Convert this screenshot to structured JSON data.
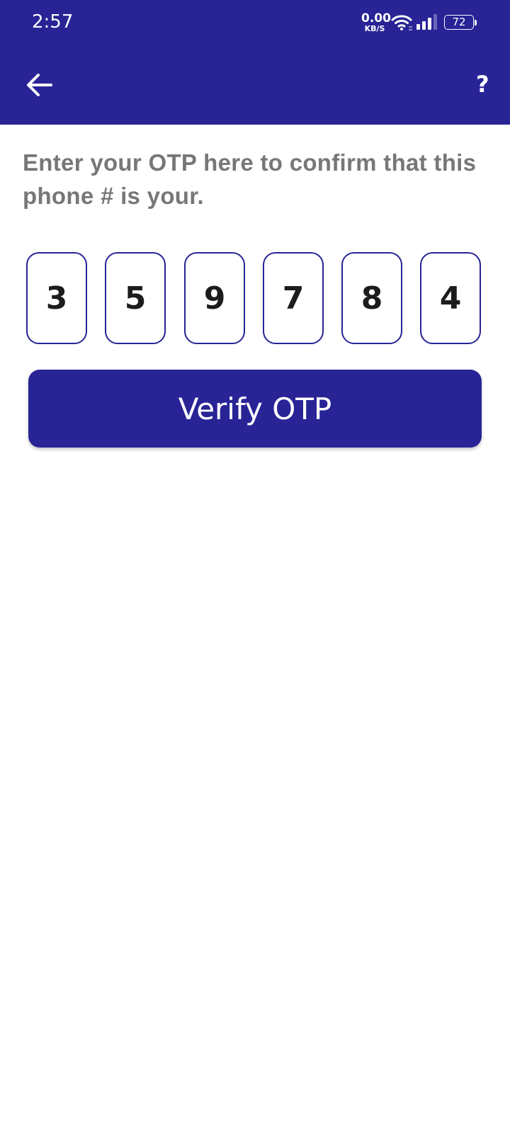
{
  "status_bar": {
    "time": "2:57",
    "net_speed_value": "0.00",
    "net_speed_unit": "KB/S",
    "battery_level": "72",
    "icons": [
      "wifi-icon",
      "signal-icon",
      "battery-icon"
    ]
  },
  "app_bar": {
    "back_icon": "arrow-left-icon",
    "help_label": "?",
    "background_color": "#282496"
  },
  "main": {
    "instructions": "Enter your OTP here to confirm that this phone # is your.",
    "otp_digits": [
      "3",
      "5",
      "9",
      "7",
      "8",
      "4"
    ],
    "verify_label": "Verify OTP"
  },
  "colors": {
    "primary": "#282496",
    "text_muted": "#777777",
    "digit_text": "#1c1c1c"
  }
}
